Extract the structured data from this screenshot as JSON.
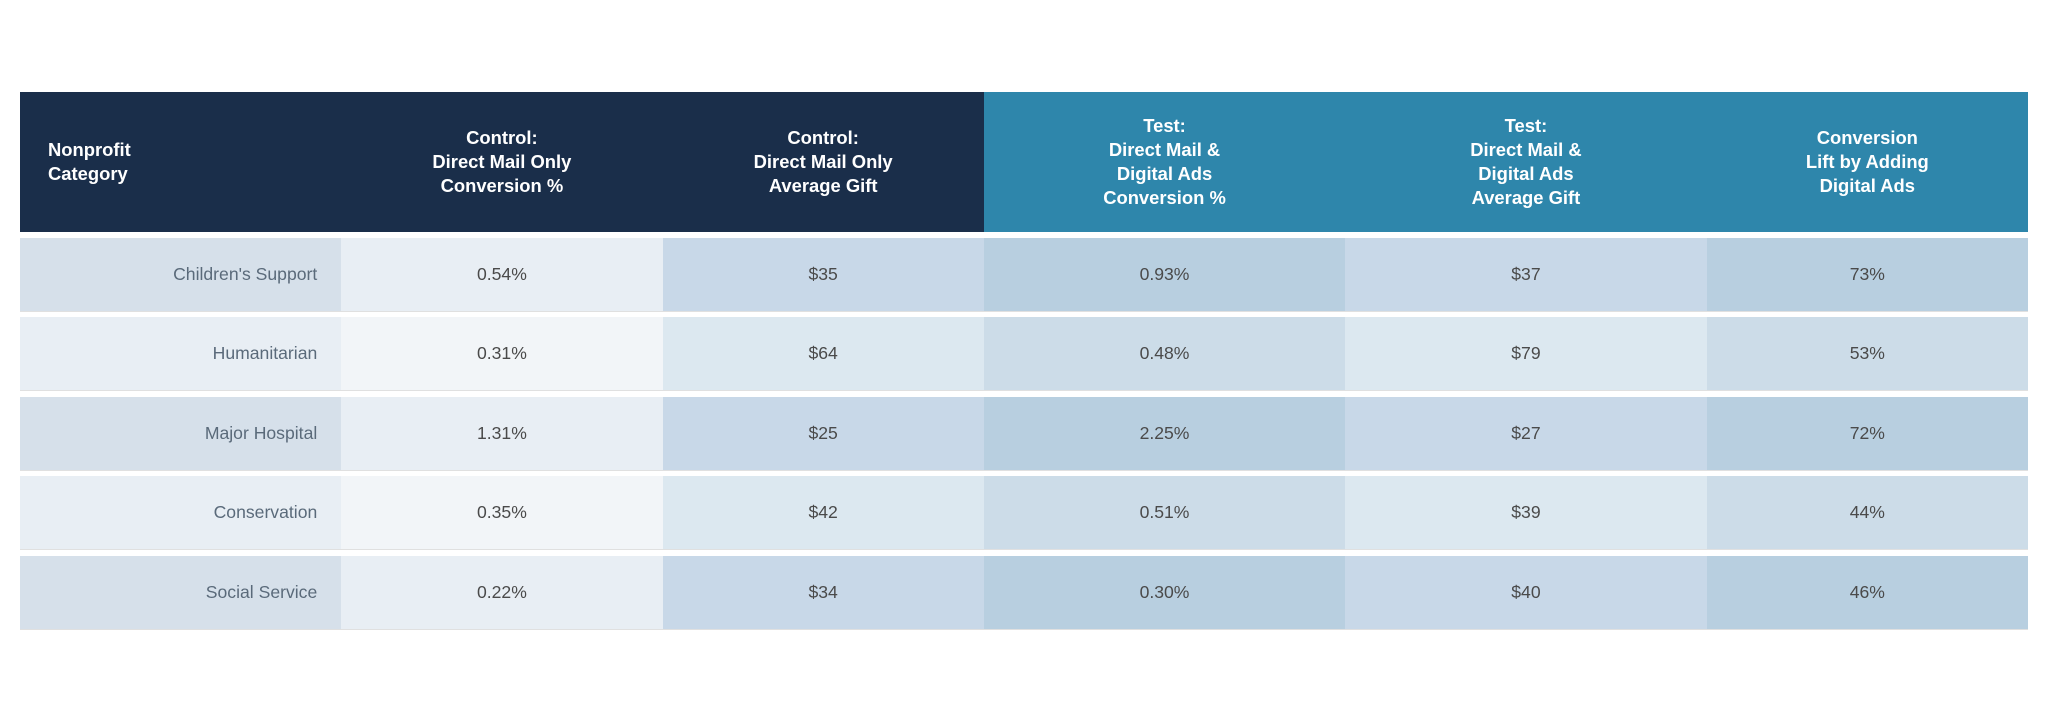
{
  "header": {
    "col1": "Nonprofit\nCategory",
    "col2": "Control:\nDirect Mail Only\nConversion %",
    "col3": "Control:\nDirect Mail Only\nAverage Gift",
    "col4": "Test:\nDirect Mail &\nDigital Ads\nConversion %",
    "col5": "Test:\nDirect Mail &\nDigital Ads\nAverage Gift",
    "col6": "Conversion\nLift by Adding\nDigital Ads"
  },
  "rows": [
    {
      "category": "Children's Support",
      "control_conversion": "0.54%",
      "control_avg_gift": "$35",
      "test_conversion": "0.93%",
      "test_avg_gift": "$37",
      "lift": "73%"
    },
    {
      "category": "Humanitarian",
      "control_conversion": "0.31%",
      "control_avg_gift": "$64",
      "test_conversion": "0.48%",
      "test_avg_gift": "$79",
      "lift": "53%"
    },
    {
      "category": "Major Hospital",
      "control_conversion": "1.31%",
      "control_avg_gift": "$25",
      "test_conversion": "2.25%",
      "test_avg_gift": "$27",
      "lift": "72%"
    },
    {
      "category": "Conservation",
      "control_conversion": "0.35%",
      "control_avg_gift": "$42",
      "test_conversion": "0.51%",
      "test_avg_gift": "$39",
      "lift": "44%"
    },
    {
      "category": "Social Service",
      "control_conversion": "0.22%",
      "control_avg_gift": "$34",
      "test_conversion": "0.30%",
      "test_avg_gift": "$40",
      "lift": "46%"
    }
  ],
  "colors": {
    "header_dark": "#1a2e4a",
    "header_blue": "#2e86ab"
  }
}
